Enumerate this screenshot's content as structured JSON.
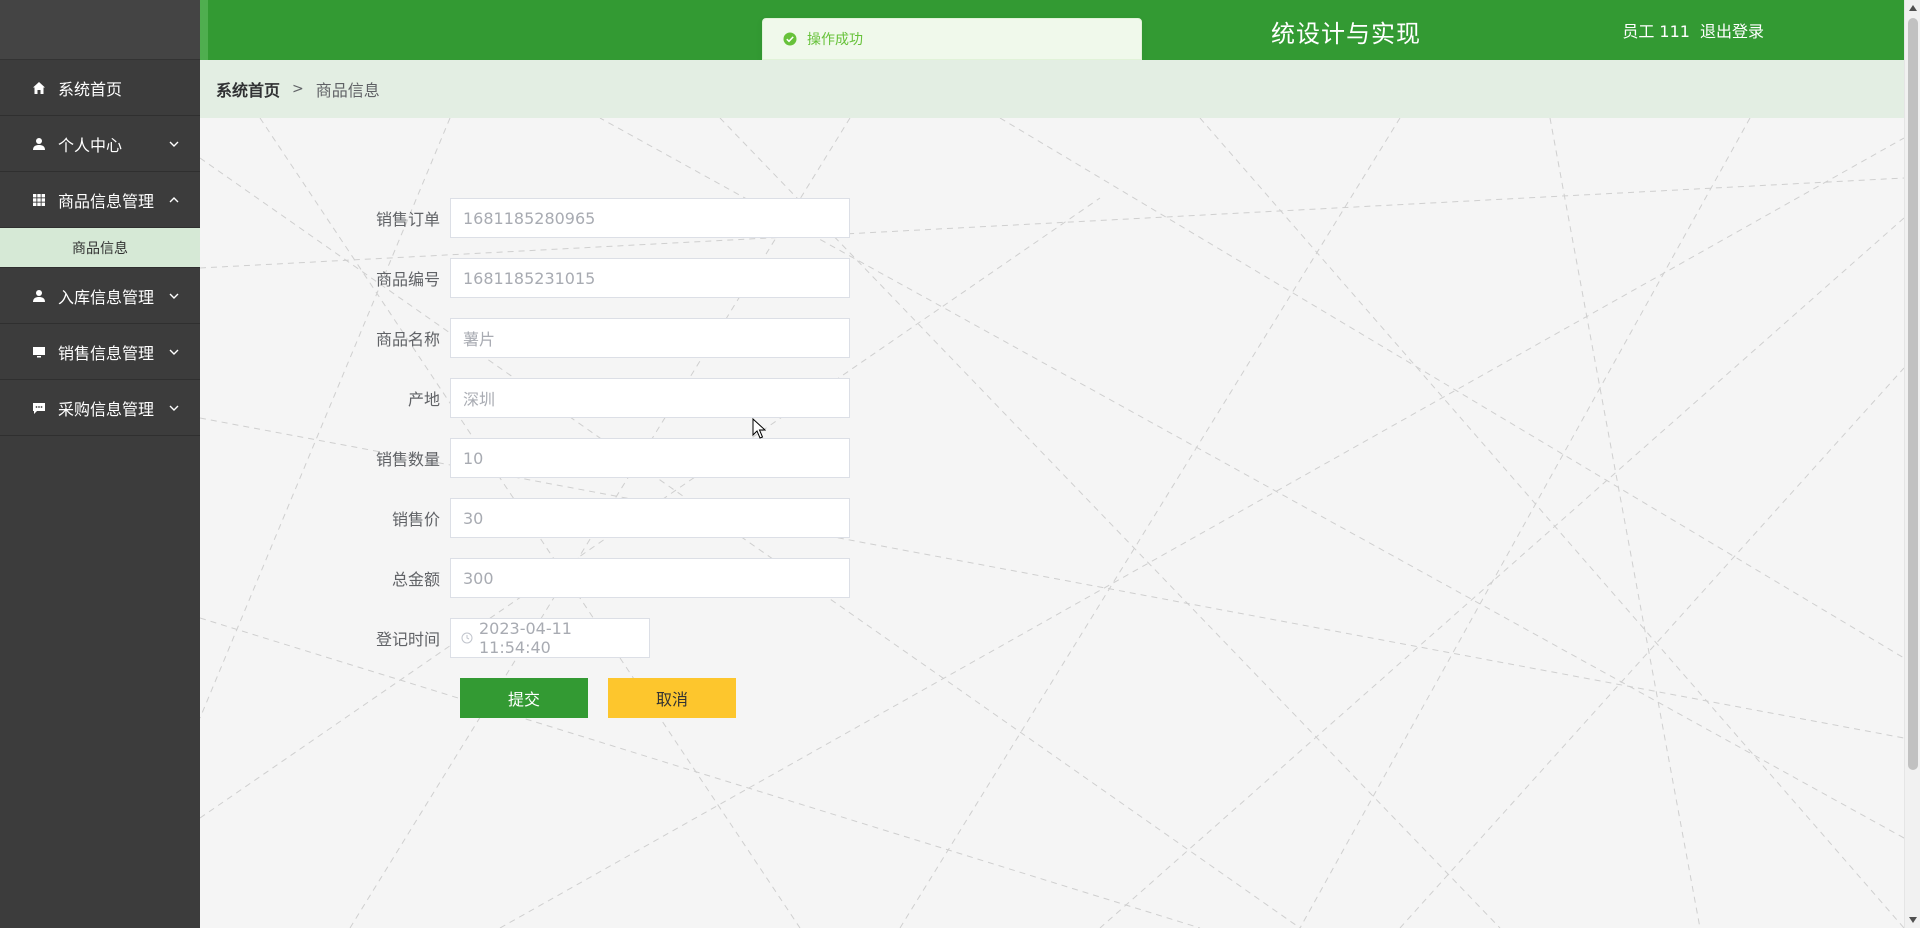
{
  "header": {
    "title": "统设计与实现",
    "user_label": "员工 111",
    "logout_label": "退出登录"
  },
  "toast": {
    "message": "操作成功"
  },
  "sidebar": {
    "items": [
      {
        "label": "系统首页",
        "icon": "home-icon"
      },
      {
        "label": "个人中心",
        "icon": "user-icon"
      },
      {
        "label": "商品信息管理",
        "icon": "grid-icon",
        "expanded": true
      },
      {
        "label": "入库信息管理",
        "icon": "user-icon"
      },
      {
        "label": "销售信息管理",
        "icon": "monitor-icon"
      },
      {
        "label": "采购信息管理",
        "icon": "chat-icon"
      }
    ],
    "submenu": {
      "label": "商品信息"
    }
  },
  "breadcrumb": {
    "home": "系统首页",
    "separator": ">",
    "current": "商品信息"
  },
  "form": {
    "fields": [
      {
        "label": "销售订单",
        "value": "1681185280965"
      },
      {
        "label": "商品编号",
        "value": "1681185231015"
      },
      {
        "label": "商品名称",
        "value": "薯片"
      },
      {
        "label": "产地",
        "value": "深圳"
      },
      {
        "label": "销售数量",
        "value": "10"
      },
      {
        "label": "销售价",
        "value": "30"
      },
      {
        "label": "总金额",
        "value": "300"
      },
      {
        "label": "登记时间",
        "value": "2023-04-11 11:54:40"
      }
    ],
    "submit_label": "提交",
    "cancel_label": "取消"
  },
  "colors": {
    "header_green": "#339a33",
    "sidebar_dark": "#3c3c3c",
    "submit_green": "#339a33",
    "cancel_yellow": "#fdc62d",
    "toast_green": "#67c23a"
  }
}
